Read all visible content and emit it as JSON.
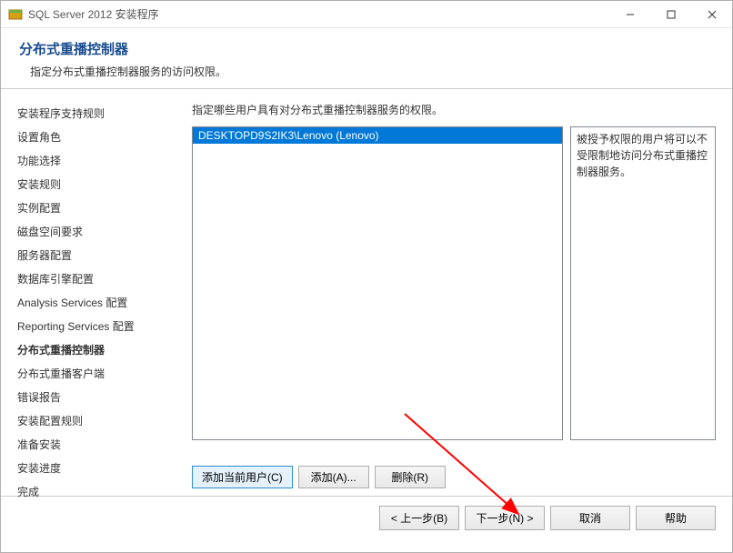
{
  "titlebar": {
    "title": "SQL Server 2012 安装程序"
  },
  "header": {
    "title": "分布式重播控制器",
    "subtitle": "指定分布式重播控制器服务的访问权限。"
  },
  "sidebar": {
    "items": [
      {
        "label": "安装程序支持规则",
        "active": false
      },
      {
        "label": "设置角色",
        "active": false
      },
      {
        "label": "功能选择",
        "active": false
      },
      {
        "label": "安装规则",
        "active": false
      },
      {
        "label": "实例配置",
        "active": false
      },
      {
        "label": "磁盘空间要求",
        "active": false
      },
      {
        "label": "服务器配置",
        "active": false
      },
      {
        "label": "数据库引擎配置",
        "active": false
      },
      {
        "label": "Analysis Services 配置",
        "active": false
      },
      {
        "label": "Reporting Services 配置",
        "active": false
      },
      {
        "label": "分布式重播控制器",
        "active": true
      },
      {
        "label": "分布式重播客户端",
        "active": false
      },
      {
        "label": "错误报告",
        "active": false
      },
      {
        "label": "安装配置规则",
        "active": false
      },
      {
        "label": "准备安装",
        "active": false
      },
      {
        "label": "安装进度",
        "active": false
      },
      {
        "label": "完成",
        "active": false
      }
    ]
  },
  "main": {
    "label": "指定哪些用户具有对分布式重播控制器服务的权限。",
    "userList": [
      "DESKTOPD9S2IK3\\Lenovo (Lenovo)"
    ],
    "infoText": "被授予权限的用户将可以不受限制地访问分布式重播控制器服务。",
    "buttons": {
      "addCurrent": "添加当前用户(C)",
      "add": "添加(A)...",
      "remove": "删除(R)"
    }
  },
  "footer": {
    "back": "< 上一步(B)",
    "next": "下一步(N) >",
    "cancel": "取消",
    "help": "帮助"
  }
}
